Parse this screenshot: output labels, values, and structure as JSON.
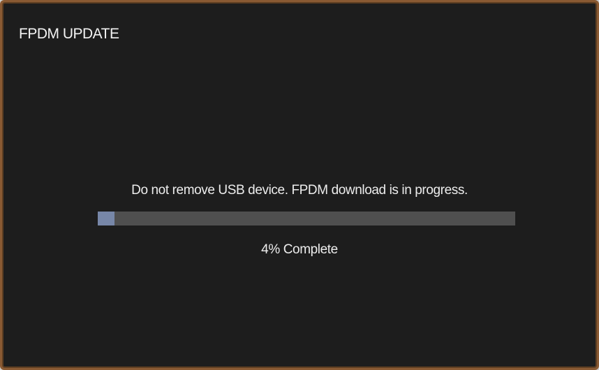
{
  "dialog": {
    "title": "FPDM UPDATE",
    "message": "Do not remove USB device. FPDM download is in progress.",
    "progress_percent": 4,
    "progress_text": "4% Complete"
  },
  "colors": {
    "frame": "#8a5a33",
    "screen_background": "#1d1d1d",
    "progress_track": "#4f4f4f",
    "progress_fill": "#7787a8",
    "text": "#ededed"
  }
}
